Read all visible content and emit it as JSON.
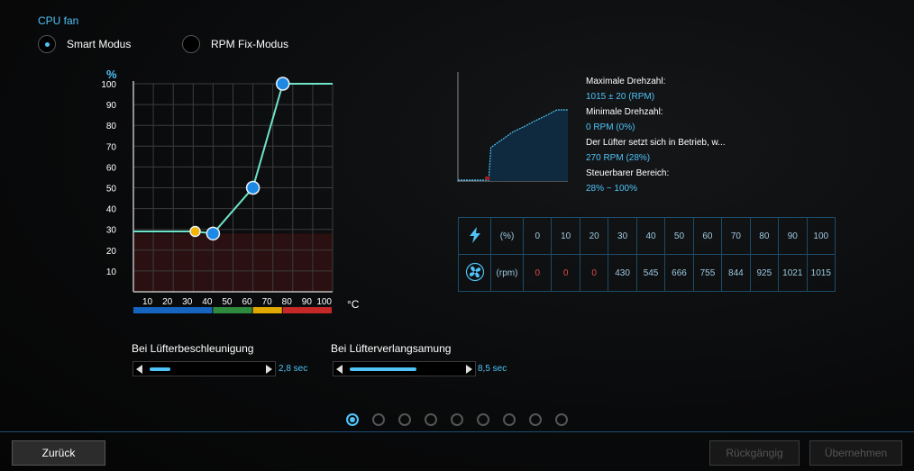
{
  "section": {
    "title": "CPU fan"
  },
  "mode": {
    "options": [
      {
        "label": "Smart Modus",
        "selected": true
      },
      {
        "label": "RPM Fix-Modus",
        "selected": false
      }
    ]
  },
  "chart_data": {
    "type": "line",
    "ylabel": "%",
    "xlabel": "°C",
    "xlim": [
      0,
      100
    ],
    "ylim": [
      0,
      100
    ],
    "x_ticks": [
      "10",
      "20",
      "30",
      "40",
      "50",
      "60",
      "70",
      "80",
      "90",
      "100"
    ],
    "y_ticks": [
      "10",
      "20",
      "30",
      "40",
      "50",
      "60",
      "70",
      "80",
      "90",
      "100"
    ],
    "grid": true,
    "curve": [
      {
        "x": 0,
        "y": 29
      },
      {
        "x": 31,
        "y": 29
      },
      {
        "x": 40,
        "y": 28
      },
      {
        "x": 60,
        "y": 50
      },
      {
        "x": 75,
        "y": 100
      },
      {
        "x": 100,
        "y": 100
      }
    ],
    "points": [
      {
        "x": 31,
        "y": 29,
        "color": "#f4b400",
        "small": true
      },
      {
        "x": 40,
        "y": 28,
        "color": "#1e88e5"
      },
      {
        "x": 60,
        "y": 50,
        "color": "#1e88e5"
      },
      {
        "x": 75,
        "y": 100,
        "color": "#1e88e5"
      }
    ],
    "stall_zone_max": 28,
    "temp_bands": [
      {
        "from": 0,
        "to": 40,
        "color": "#1565c0"
      },
      {
        "from": 40,
        "to": 60,
        "color": "#2e8b3e"
      },
      {
        "from": 60,
        "to": 75,
        "color": "#e0a800"
      },
      {
        "from": 75,
        "to": 100,
        "color": "#c62828"
      }
    ]
  },
  "rpm_curve_preview": {
    "rpm_pct_curve": [
      0,
      0,
      0,
      42,
      54,
      66,
      74,
      83,
      91,
      100,
      100
    ],
    "start_pct": 28,
    "fill_color": "#0f2a3e",
    "line_color": "#4fc3f7"
  },
  "info": {
    "max_label": "Maximale Drehzahl:",
    "max_value": "1015 ± 20 (RPM)",
    "min_label": "Minimale Drehzahl:",
    "min_value": "0 RPM (0%)",
    "start_label": "Der Lüfter setzt sich in Betrieb, w...",
    "start_value": "270 RPM (28%)",
    "range_label": "Steuerbarer Bereich:",
    "range_value": "28% ~ 100%"
  },
  "rpm_table": {
    "pct_unit": "(%)",
    "rpm_unit": "(rpm)",
    "pct": [
      "0",
      "10",
      "20",
      "30",
      "40",
      "50",
      "60",
      "70",
      "80",
      "90",
      "100"
    ],
    "rpm": [
      "0",
      "0",
      "0",
      "430",
      "545",
      "666",
      "755",
      "844",
      "925",
      "1021",
      "1015"
    ]
  },
  "sliders": {
    "accel": {
      "label": "Bei Lüfterbeschleunigung",
      "value": "2,8 sec",
      "fraction": 0.19
    },
    "decel": {
      "label": "Bei Lüfterverlangsamung",
      "value": "8,5 sec",
      "fraction": 0.6
    }
  },
  "pagination": {
    "count": 9,
    "active": 0
  },
  "footer": {
    "back": "Zurück",
    "undo": "Rückgängig",
    "apply": "Übernehmen"
  },
  "colors": {
    "accent": "#4fc3f7",
    "curve": "#6fe3c8",
    "stall_zone": "#2a1010"
  }
}
